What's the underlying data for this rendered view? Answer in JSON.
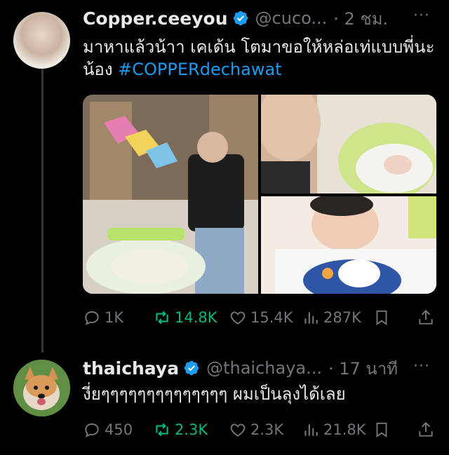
{
  "post": {
    "author_name": "Copper.ceeyou",
    "handle": "@cuco...",
    "time": "· 2 ชม.",
    "text": "มาหาแล้วน้าา เคเด้น โตมาขอให้หล่อเท่แบบพี่นะน้อง ",
    "hashtag": "#COPPERdechawat",
    "more": "···",
    "replies": "1K",
    "retweets": "14.8K",
    "likes": "15.4K",
    "views": "287K"
  },
  "reply": {
    "author_name": "thaichaya",
    "handle": "@thaichaya...",
    "time": "· 17 นาที",
    "text": "งี่ยๆๆๆๆๆๆๆๆๆๆๆๆๆๆ ผมเป็นลุงได้เลย",
    "more": "···",
    "replies": "450",
    "retweets": "2.3K",
    "likes": "2.3K",
    "views": "21.8K"
  },
  "colors": {
    "verified": "#1d9bf0",
    "retweet": "#00ba7c",
    "hashtag": "#1d9bf0",
    "muted": "#71767b"
  },
  "icons": [
    "verified-badge-icon",
    "reply-icon",
    "retweet-icon",
    "like-icon",
    "views-icon",
    "bookmark-icon",
    "share-icon",
    "more-icon"
  ]
}
